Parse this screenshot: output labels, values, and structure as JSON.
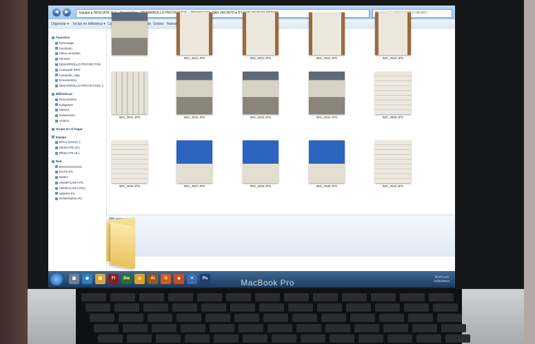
{
  "explorer": {
    "address": "Equipo ▸ RESCATE (E:) ▸ Desarrollos ▸ DESARROLLO PROYECTOS ▸ PROYECTO_SAN JACINTO ▸ FT-SANJACINTO HENRY",
    "search_placeholder": "Buscar FT-SANJACINTO HENRY",
    "toolbar": [
      "Organizar ▾",
      "Incluir en biblioteca ▾",
      "Compartir con ▾",
      "Presentación",
      "Grabar",
      "Nueva carpeta"
    ],
    "sidebar": [
      {
        "label": "Favoritos",
        "h": true
      },
      {
        "label": "Descargas"
      },
      {
        "label": "Escritorio"
      },
      {
        "label": "Sitios recientes"
      },
      {
        "label": "clientes"
      },
      {
        "label": "DESARROLLO PROYECTOS"
      },
      {
        "label": "Compartir EMY"
      },
      {
        "label": "compartir_naty"
      },
      {
        "label": "Documentos"
      },
      {
        "label": "DESARROLLO PROYECTOS 2"
      },
      {
        "label": "Bibliotecas",
        "h": true
      },
      {
        "label": "Documentos"
      },
      {
        "label": "Imágenes"
      },
      {
        "label": "Música"
      },
      {
        "label": "Subversion"
      },
      {
        "label": "Vídeos"
      },
      {
        "label": "Grupo en el hogar",
        "h": true
      },
      {
        "label": "Equipo",
        "h": true
      },
      {
        "label": "Disco local (C:)"
      },
      {
        "label": "RESCATE (D:)"
      },
      {
        "label": "RESCATE (E:)"
      },
      {
        "label": "Red",
        "h": true
      },
      {
        "label": "BXXXXXXXXXX"
      },
      {
        "label": "ELVIS-PC"
      },
      {
        "label": "EMILY"
      },
      {
        "label": "HENRYLARA-PC"
      },
      {
        "label": "HENRYLARA-PCC"
      },
      {
        "label": "HENRY-PC"
      },
      {
        "label": "INTERNOVA-PC"
      }
    ],
    "thumbs": [
      {
        "cap": "",
        "t": "fac"
      },
      {
        "cap": "IMG_3822.JPG",
        "t": "rack"
      },
      {
        "cap": "IMG_3823.JPG",
        "t": "rack"
      },
      {
        "cap": "IMG_3824.JPG",
        "t": "rack"
      },
      {
        "cap": "IMG_3825.JPG",
        "t": "rack"
      },
      {
        "cap": "IMG_3831.JPG",
        "t": "wh"
      },
      {
        "cap": "IMG_3832.JPG",
        "t": "fac"
      },
      {
        "cap": "IMG_3833.JPG",
        "t": "fac"
      },
      {
        "cap": "IMG_3834.JPG",
        "t": "fac"
      },
      {
        "cap": "IMG_3835.JPG",
        "t": "wh b"
      },
      {
        "cap": "IMG_3836.JPG",
        "t": "wh b"
      },
      {
        "cap": "IMG_3837.JPG",
        "t": "blue"
      },
      {
        "cap": "IMG_3838.JPG",
        "t": "blue"
      },
      {
        "cap": "IMG_3839.JPG",
        "t": "blue"
      },
      {
        "cap": "IMG_3840.JPG",
        "t": "wh b"
      }
    ],
    "status": "680 elementos"
  },
  "taskbar": {
    "icons": [
      {
        "l": "▣",
        "c": "#6d7f93"
      },
      {
        "l": "◉",
        "c": "#2d7fc4"
      },
      {
        "l": "▤",
        "c": "#d6a43a"
      },
      {
        "l": "Fl",
        "c": "#8c1d1d"
      },
      {
        "l": "Dw",
        "c": "#2f6e2a"
      },
      {
        "l": "◎",
        "c": "#e3a019"
      },
      {
        "l": "Ai",
        "c": "#9a5a10"
      },
      {
        "l": "O",
        "c": "#d35b16"
      },
      {
        "l": "◆",
        "c": "#cf4a1f"
      },
      {
        "l": "✦",
        "c": "#3c6cb4"
      },
      {
        "l": "Ps",
        "c": "#1b3f72"
      }
    ],
    "clock": [
      "09:27 p.m.",
      "21/01/2014"
    ]
  },
  "brand": "MacBook Pro"
}
